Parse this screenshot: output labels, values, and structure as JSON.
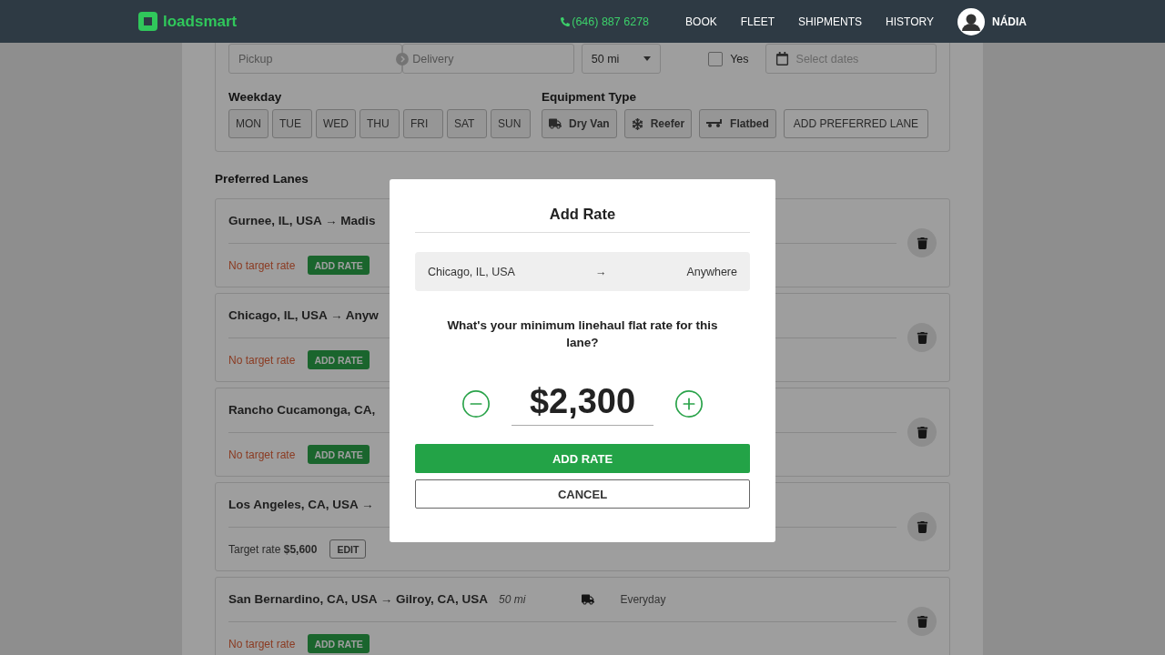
{
  "header": {
    "logo": "loadsmart",
    "phone": "(646) 887 6278",
    "nav": [
      {
        "label": "BOOK"
      },
      {
        "label": "FLEET"
      },
      {
        "label": "SHIPMENTS"
      },
      {
        "label": "HISTORY"
      }
    ],
    "user": "NÁDIA"
  },
  "filters": {
    "pickup": {
      "placeholder": "Pickup"
    },
    "delivery": {
      "placeholder": "Delivery"
    },
    "radius": "50 mi",
    "flexible": {
      "label": "Yes",
      "checked": false
    },
    "dates": {
      "placeholder": "Select dates"
    },
    "weekday_label": "Weekday",
    "weekdays": [
      {
        "label": "MON",
        "selected": false
      },
      {
        "label": "TUE",
        "selected": false
      },
      {
        "label": "WED",
        "selected": false
      },
      {
        "label": "THU",
        "selected": false
      },
      {
        "label": "FRI",
        "selected": false
      },
      {
        "label": "SAT",
        "selected": false
      },
      {
        "label": "SUN",
        "selected": false
      }
    ],
    "equipment_label": "Equipment Type",
    "equipment": [
      {
        "label": "Dry Van",
        "kind": "van",
        "selected": false
      },
      {
        "label": "Reefer",
        "kind": "reefer",
        "selected": false
      },
      {
        "label": "Flatbed",
        "kind": "flatbed",
        "selected": false
      }
    ],
    "add_lane": "ADD PREFERRED LANE"
  },
  "lanes_heading": "Preferred Lanes",
  "lanes": [
    {
      "title": "Gurnee, IL, USA → Madis",
      "kind": "no_rate",
      "rate_text": "No target rate",
      "action": "ADD RATE"
    },
    {
      "title": "Chicago, IL, USA → Anyw",
      "kind": "no_rate",
      "rate_text": "No target rate",
      "action": "ADD RATE"
    },
    {
      "title": "Rancho Cucamonga, CA,",
      "kind": "no_rate",
      "rate_text": "No target rate",
      "action": "ADD RATE"
    },
    {
      "title": "Los Angeles, CA, USA →",
      "kind": "target_rate",
      "rate_text": "Target rate **$5,600**",
      "action": "EDIT"
    },
    {
      "title": "San Bernardino, CA, USA → Gilroy, CA, USA",
      "distance": "50 mi",
      "equipment": {
        "kind": "van"
      },
      "days": "Everyday",
      "kind": "no_rate",
      "rate_text": "No target rate",
      "action": "ADD RATE"
    }
  ],
  "modal": {
    "title": "Add Rate",
    "origin": "Chicago, IL, USA",
    "arrow": "→",
    "destination": "Anywhere",
    "question": "What's your minimum linehaul flat rate for this lane?",
    "amount": "$2,300",
    "confirm": "ADD RATE",
    "cancel": "CANCEL"
  }
}
